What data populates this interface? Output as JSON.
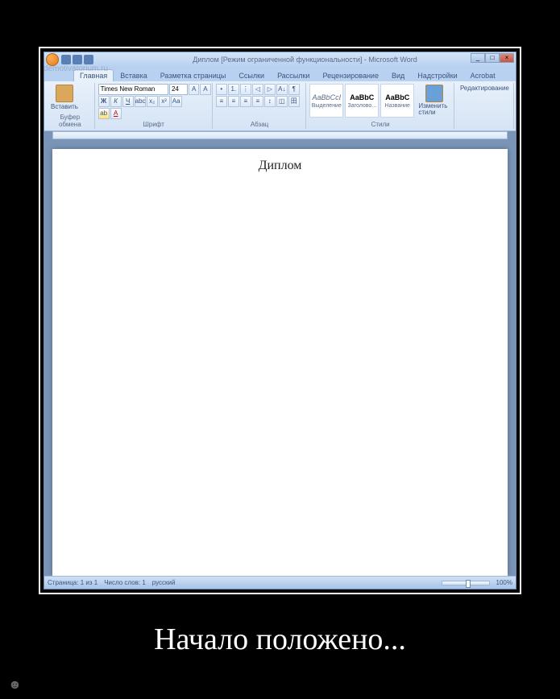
{
  "demotivator": {
    "caption": "Начало положено...",
    "watermark": "demotivatorium.ru",
    "site_icon": "☻"
  },
  "titlebar": {
    "title": "Диплом [Режим ограниченной функциональности] - Microsoft Word",
    "min": "_",
    "max": "□",
    "close": "×"
  },
  "tabs": {
    "home": "Главная",
    "insert": "Вставка",
    "layout": "Разметка страницы",
    "refs": "Ссылки",
    "mail": "Рассылки",
    "review": "Рецензирование",
    "view": "Вид",
    "addins": "Надстройки",
    "acrobat": "Acrobat"
  },
  "clipboard": {
    "paste": "Вставить",
    "group": "Буфер обмена"
  },
  "font": {
    "family": "Times New Roman",
    "size": "24",
    "group": "Шрифт",
    "bold": "Ж",
    "italic": "К",
    "underline": "Ч"
  },
  "paragraph": {
    "group": "Абзац"
  },
  "styles": {
    "group": "Стили",
    "s1_preview": "AaBbCcI",
    "s1_label": "Выделение",
    "s2_preview": "AaBbC",
    "s2_label": "Заголово...",
    "s3_preview": "AaBbC",
    "s3_label": "Название",
    "change": "Изменить стили"
  },
  "editing": {
    "label": "Редактирование"
  },
  "document": {
    "title": "Диплом"
  },
  "status": {
    "page": "Страница: 1 из 1",
    "words": "Число слов: 1",
    "lang": "русский",
    "zoom": "100%"
  }
}
